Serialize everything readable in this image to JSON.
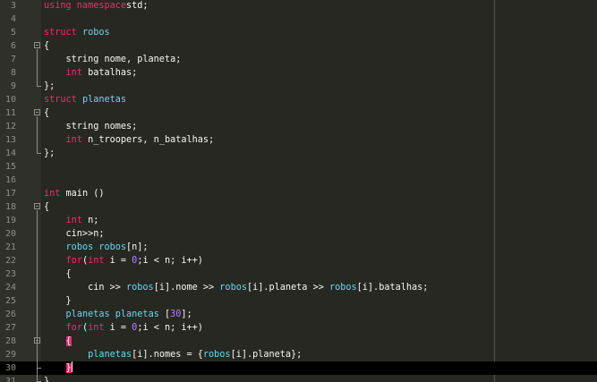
{
  "colors": {
    "background": "#272822",
    "gutter": "#2f302a",
    "keyword": "#f92672",
    "type": "#66d9ef",
    "number": "#ae81ff",
    "text": "#f8f8f2",
    "line_number": "#8f908a",
    "current_line": "#000000",
    "bracket_match": "#f92672"
  },
  "editor": {
    "current_line": 30,
    "fold_markers": [
      6,
      11,
      18,
      28
    ],
    "lines": [
      {
        "n": "3",
        "segs": [
          [
            "kw",
            "using namespace"
          ],
          [
            "",
            "std;"
          ]
        ]
      },
      {
        "n": "4",
        "segs": []
      },
      {
        "n": "5",
        "segs": [
          [
            "kw",
            "struct"
          ],
          [
            "",
            " "
          ],
          [
            "ty",
            "robos"
          ]
        ]
      },
      {
        "n": "6",
        "segs": [
          [
            "",
            "{"
          ]
        ]
      },
      {
        "n": "7",
        "segs": [
          [
            "",
            "    string nome, planeta;"
          ]
        ]
      },
      {
        "n": "8",
        "segs": [
          [
            "",
            "    "
          ],
          [
            "kw",
            "int"
          ],
          [
            "",
            " batalhas;"
          ]
        ]
      },
      {
        "n": "9",
        "segs": [
          [
            "",
            "};"
          ]
        ]
      },
      {
        "n": "10",
        "segs": [
          [
            "kw",
            "struct"
          ],
          [
            "",
            " "
          ],
          [
            "ty",
            "planetas"
          ]
        ]
      },
      {
        "n": "11",
        "segs": [
          [
            "",
            "{"
          ]
        ]
      },
      {
        "n": "12",
        "segs": [
          [
            "",
            "    string nomes;"
          ]
        ]
      },
      {
        "n": "13",
        "segs": [
          [
            "",
            "    "
          ],
          [
            "kw",
            "int"
          ],
          [
            "",
            " n_troopers, n_batalhas;"
          ]
        ]
      },
      {
        "n": "14",
        "segs": [
          [
            "",
            "};"
          ]
        ]
      },
      {
        "n": "15",
        "segs": []
      },
      {
        "n": "16",
        "segs": []
      },
      {
        "n": "17",
        "segs": [
          [
            "kw",
            "int"
          ],
          [
            "",
            " main ()"
          ]
        ]
      },
      {
        "n": "18",
        "segs": [
          [
            "",
            "{"
          ]
        ]
      },
      {
        "n": "19",
        "segs": [
          [
            "",
            "    "
          ],
          [
            "kw",
            "int"
          ],
          [
            "",
            " n;"
          ]
        ]
      },
      {
        "n": "20",
        "segs": [
          [
            "",
            "    cin>>n;"
          ]
        ]
      },
      {
        "n": "21",
        "segs": [
          [
            "",
            "    "
          ],
          [
            "ty",
            "robos"
          ],
          [
            "",
            " "
          ],
          [
            "ty",
            "robos"
          ],
          [
            "",
            "[n];"
          ]
        ]
      },
      {
        "n": "22",
        "segs": [
          [
            "",
            "    "
          ],
          [
            "kw",
            "for"
          ],
          [
            "",
            "("
          ],
          [
            "kw",
            "int"
          ],
          [
            "",
            " i = "
          ],
          [
            "num",
            "0"
          ],
          [
            "",
            ";i < n; i++)"
          ]
        ]
      },
      {
        "n": "23",
        "segs": [
          [
            "",
            "    {"
          ]
        ]
      },
      {
        "n": "24",
        "segs": [
          [
            "",
            "        cin >> "
          ],
          [
            "ty",
            "robos"
          ],
          [
            "",
            "[i].nome >> "
          ],
          [
            "ty",
            "robos"
          ],
          [
            "",
            "[i].planeta >> "
          ],
          [
            "ty",
            "robos"
          ],
          [
            "",
            "[i].batalhas;"
          ]
        ]
      },
      {
        "n": "25",
        "segs": [
          [
            "",
            "    }"
          ]
        ]
      },
      {
        "n": "26",
        "segs": [
          [
            "",
            "    "
          ],
          [
            "ty",
            "planetas"
          ],
          [
            "",
            " "
          ],
          [
            "ty",
            "planetas"
          ],
          [
            "",
            " ["
          ],
          [
            "num",
            "30"
          ],
          [
            "",
            "];"
          ]
        ]
      },
      {
        "n": "27",
        "segs": [
          [
            "",
            "    "
          ],
          [
            "kw",
            "for"
          ],
          [
            "",
            "("
          ],
          [
            "kw",
            "int"
          ],
          [
            "",
            " i = "
          ],
          [
            "num",
            "0"
          ],
          [
            "",
            ";i < n; i++)"
          ]
        ]
      },
      {
        "n": "28",
        "segs": [
          [
            "",
            "    "
          ],
          [
            "brm",
            "{"
          ]
        ]
      },
      {
        "n": "29",
        "segs": [
          [
            "",
            "        "
          ],
          [
            "ty",
            "planetas"
          ],
          [
            "",
            "[i].nomes = {"
          ],
          [
            "ty",
            "robos"
          ],
          [
            "",
            "[i].planeta};"
          ]
        ]
      },
      {
        "n": "30",
        "segs": [
          [
            "",
            "    "
          ],
          [
            "brm",
            "}"
          ]
        ]
      },
      {
        "n": "31",
        "segs": [
          [
            "",
            "}"
          ]
        ]
      }
    ]
  }
}
